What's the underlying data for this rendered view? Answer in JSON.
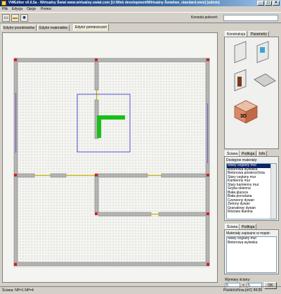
{
  "window": {
    "title": "VWEditor v0.6.5a - Wirtualny Świat www.wirtualny-swiat.com [U:\\Web development\\Wirtualny Świat\\ws_standard.ewm] (admin)"
  },
  "menu": {
    "items": [
      "Plik",
      "Edycja",
      "Opcje",
      "Pomoc"
    ]
  },
  "toolbar": {
    "console_label": "Konsola poleceń:",
    "console_value": ""
  },
  "tabs": [
    "Edytor przedmiotów",
    "Edytor materiałów",
    "Edytor pomieszczeń"
  ],
  "right_tabs": [
    "Konstrukcja",
    "Parametry"
  ],
  "mid_tabs": [
    "Ściana",
    "Podłoga",
    "Info"
  ],
  "materials_label": "Dostępne materiały:",
  "materials": [
    "Nowy ceglany mur",
    "Betonowa wylewka",
    "Betonowa powierzchnia",
    "Stary ceglany mur",
    "Kamienny mur",
    "Stary kamienny mur",
    "Szyba okienna",
    "Biała glazura",
    "Biała porcelana",
    "Czerwony dywan",
    "Zielony dywan",
    "Granatowy dywan",
    "Różowa tkanina"
  ],
  "lower_tabs": [
    "Ściana",
    "Podłoga"
  ],
  "saved_label": "Materiały zapisane w mapie:",
  "saved_materials": [
    "Nowy ceglany mur",
    "Betonowa wylewka"
  ],
  "wall_size": {
    "label": "Wymiary ściany:",
    "w": "5",
    "h": "5",
    "ok": "OK"
  },
  "threeD_label": "3D",
  "status": {
    "left": "Ściana: NP=1 NP=4",
    "right": "Powierzchnia [m²]: 44.00"
  }
}
